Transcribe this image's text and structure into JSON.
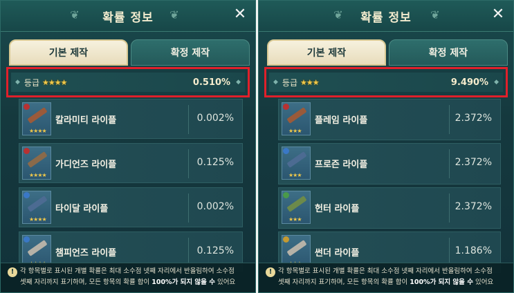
{
  "left": {
    "title": "확률 정보",
    "close_label": "✕",
    "tabs": [
      {
        "label": "기본 제작",
        "active": true
      },
      {
        "label": "확정 제작",
        "active": false
      }
    ],
    "grade": {
      "label": "등급",
      "stars": "★★★★",
      "value": "0.510%"
    },
    "items": [
      {
        "name": "칼라미티 라이플",
        "value": "0.002%",
        "stars": "★★★★",
        "badge": "red"
      },
      {
        "name": "가디언즈 라이플",
        "value": "0.125%",
        "stars": "★★★★",
        "badge": "red"
      },
      {
        "name": "타이달 라이플",
        "value": "0.002%",
        "stars": "★★★★",
        "badge": "blue"
      },
      {
        "name": "챔피언즈 라이플",
        "value": "0.125%",
        "stars": "★★★★",
        "badge": "blue"
      }
    ],
    "footer": {
      "line1": "각 항목별로 표시된 개별 확률은 최대 소수점 넷째 자리에서 반올림하여 소수점",
      "line2_prefix": "셋째 자리까지 표기하며, 모든 항목의 확률 합이 ",
      "line2_bold": "100%가 되지 않을 수",
      "line2_suffix": " 있어요"
    }
  },
  "right": {
    "title": "확률 정보",
    "close_label": "✕",
    "tabs": [
      {
        "label": "기본 제작",
        "active": true
      },
      {
        "label": "확정 제작",
        "active": false
      }
    ],
    "grade": {
      "label": "등급",
      "stars": "★★★",
      "value": "9.490%"
    },
    "items": [
      {
        "name": "플레임 라이플",
        "value": "2.372%",
        "stars": "★★★",
        "badge": "red"
      },
      {
        "name": "프로즌 라이플",
        "value": "2.372%",
        "stars": "★★★",
        "badge": "blue"
      },
      {
        "name": "헌터 라이플",
        "value": "2.372%",
        "stars": "★★★",
        "badge": "green"
      },
      {
        "name": "썬더 라이플",
        "value": "1.186%",
        "stars": "★★★",
        "badge": "gold"
      }
    ],
    "footer": {
      "line1": "각 항목별로 표시된 개별 확률은 최대 소수점 넷째 자리에서 반올림하여 소수점",
      "line2_prefix": "셋째 자리까지 표기하며, 모든 항목의 확률 합이 ",
      "line2_bold": "100%가 되지 않을 수",
      "line2_suffix": " 있어요"
    }
  },
  "colors": {
    "highlight": "#e0202a",
    "star": "#f0c84a",
    "active_tab": "#f6f1de",
    "inactive_tab": "#2e6e6c"
  },
  "icons": {
    "close": "close-icon",
    "leaf": "leaf-ornament-icon",
    "info": "info-icon",
    "weapon": "rifle-icon"
  }
}
